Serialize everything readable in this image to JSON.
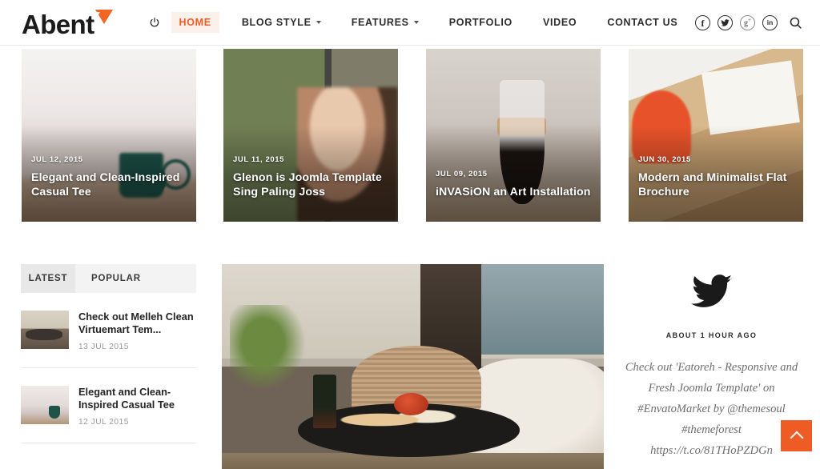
{
  "site": {
    "logo_text": "Abent",
    "logo_accent_color": "#f26522",
    "accent_color": "#ef5b25"
  },
  "nav": {
    "power_icon": "power-icon",
    "items": [
      {
        "label": "HOME",
        "active": true,
        "caret": false
      },
      {
        "label": "BLOG STYLE",
        "active": false,
        "caret": true
      },
      {
        "label": "FEATURES",
        "active": false,
        "caret": true
      },
      {
        "label": "PORTFOLIO",
        "active": false,
        "caret": false
      },
      {
        "label": "VIDEO",
        "active": false,
        "caret": false
      },
      {
        "label": "CONTACT US",
        "active": false,
        "caret": false
      }
    ],
    "social": [
      {
        "name": "facebook-icon",
        "glyph": "f"
      },
      {
        "name": "twitter-icon",
        "glyph": ""
      },
      {
        "name": "google-plus-icon",
        "glyph": "g+"
      },
      {
        "name": "linkedin-icon",
        "glyph": "in"
      }
    ],
    "search_icon": "search-icon"
  },
  "featured": [
    {
      "date": "JUL 12, 2015",
      "title": "Elegant and Clean-Inspired Casual Tee",
      "photo": "coffee-mug-on-table"
    },
    {
      "date": "JUL 11, 2015",
      "title": "Glenon is Joomla Template Sing Paling Joss",
      "photo": "child-at-rainy-window"
    },
    {
      "date": "JUL 09, 2015",
      "title": "iNVASiON an Art Installation",
      "photo": "coffee-carafe"
    },
    {
      "date": "JUN 30, 2015",
      "title": "Modern and Minimalist Flat Brochure",
      "photo": "desk-with-orange-chair"
    }
  ],
  "latest_widget": {
    "tabs": [
      {
        "label": "LATEST",
        "active": true
      },
      {
        "label": "POPULAR",
        "active": false
      }
    ],
    "posts": [
      {
        "title": "Check out Melleh Clean Virtuemart Tem...",
        "date": "13 JUL 2015",
        "thumb": "outdoor-table-with-food"
      },
      {
        "title": "Elegant and Clean-Inspired Casual Tee",
        "date": "12 JUL 2015",
        "thumb": "green-mug-on-bed"
      }
    ]
  },
  "center_media": {
    "alt": "outdoor-patio-table-with-wine-and-food"
  },
  "twitter_widget": {
    "icon": "twitter-bird-icon",
    "time_ago": "ABOUT 1 HOUR AGO",
    "tweet": "Check out 'Eatoreh - Responsive and Fresh Joomla Template' on #EnvatoMarket by @themesoul #themeforest https://t.co/81THoPZDGn"
  },
  "scroll_top": {
    "label": "scroll-to-top",
    "icon": "chevron-up-icon",
    "color": "#ef5b25"
  }
}
